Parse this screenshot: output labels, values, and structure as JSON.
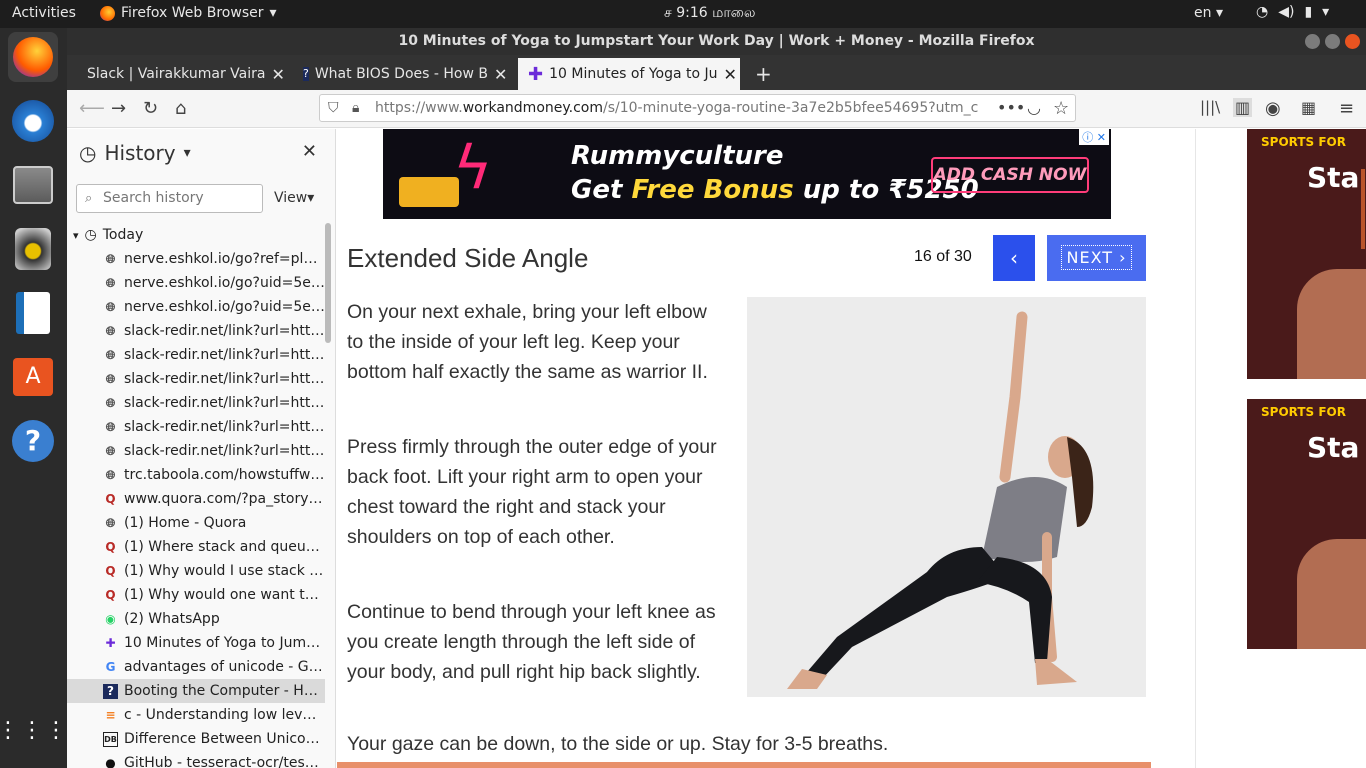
{
  "topbar": {
    "activities": "Activities",
    "app_name": "Firefox Web Browser",
    "clock": "ச  9:16 மாலை",
    "lang": "en"
  },
  "window": {
    "title": "10 Minutes of Yoga to Jumpstart Your Work Day | Work + Money - Mozilla Firefox"
  },
  "tabs": [
    {
      "label": "Slack | Vairakkumar Vaira"
    },
    {
      "label": "What BIOS Does - How B"
    },
    {
      "label": "10 Minutes of Yoga to Ju"
    }
  ],
  "url": {
    "prefix": "https://www.",
    "domain": "workandmoney.com",
    "path": "/s/10-minute-yoga-routine-3a7e2b5bfee54695?utm_c"
  },
  "sidebar": {
    "title": "History",
    "search_placeholder": "Search history",
    "view_label": "View",
    "today_label": "Today",
    "items": [
      {
        "label": "nerve.eshkol.io/go?ref=pl&h...",
        "icon": "globe"
      },
      {
        "label": "nerve.eshkol.io/go?uid=5e1...",
        "icon": "globe"
      },
      {
        "label": "nerve.eshkol.io/go?uid=5e1...",
        "icon": "globe"
      },
      {
        "label": "slack-redir.net/link?url=http...",
        "icon": "globe"
      },
      {
        "label": "slack-redir.net/link?url=http...",
        "icon": "globe"
      },
      {
        "label": "slack-redir.net/link?url=http...",
        "icon": "globe"
      },
      {
        "label": "slack-redir.net/link?url=http...",
        "icon": "globe"
      },
      {
        "label": "slack-redir.net/link?url=http...",
        "icon": "globe"
      },
      {
        "label": "slack-redir.net/link?url=http...",
        "icon": "globe"
      },
      {
        "label": "trc.taboola.com/howstuffwo...",
        "icon": "globe"
      },
      {
        "label": "www.quora.com/?pa_story=...",
        "icon": "quora"
      },
      {
        "label": "(1) Home - Quora",
        "icon": "globe"
      },
      {
        "label": "(1) Where stack and queue u...",
        "icon": "quora"
      },
      {
        "label": "(1) Why would I use stack ins...",
        "icon": "quora"
      },
      {
        "label": "(1) Why would one want to u...",
        "icon": "quora"
      },
      {
        "label": "(2) WhatsApp",
        "icon": "whatsapp"
      },
      {
        "label": "10 Minutes of Yoga to Jump...",
        "icon": "plus"
      },
      {
        "label": "advantages of unicode - Goo...",
        "icon": "google"
      },
      {
        "label": "Booting the Computer - How...",
        "icon": "howstuff"
      },
      {
        "label": "c - Understanding low level f...",
        "icon": "stackoverflow"
      },
      {
        "label": "Difference Between Unicod...",
        "icon": "db"
      },
      {
        "label": "GitHub - tesseract-ocr/tessd...",
        "icon": "github"
      }
    ]
  },
  "ad": {
    "brand": "Rummyculture",
    "tag_pre": "Get ",
    "tag_hl": "Free Bonus",
    "tag_post": " up to ₹5250",
    "cta": "ADD CASH NOW"
  },
  "article": {
    "heading": "Extended Side Angle",
    "counter": "16 of 30",
    "prev_label": "‹",
    "next_label": "NEXT ›",
    "paragraphs": [
      "On your next exhale, bring your left elbow to the inside of your left leg. Keep your bottom half exactly the same as warrior II.",
      "Press firmly through the outer edge of your back foot. Lift your right arm to open your chest toward the right and stack your shoulders on top of each other.",
      "Continue to bend through your left knee as you create length through the left side of your body, and pull right hip back slightly."
    ],
    "last_line": "Your gaze can be down, to the side or up. Stay for 3-5 breaths."
  },
  "side_ads": [
    {
      "kicker": "SPORTS FOR",
      "word": "Sta"
    },
    {
      "kicker": "SPORTS FOR",
      "word": "Sta"
    }
  ]
}
